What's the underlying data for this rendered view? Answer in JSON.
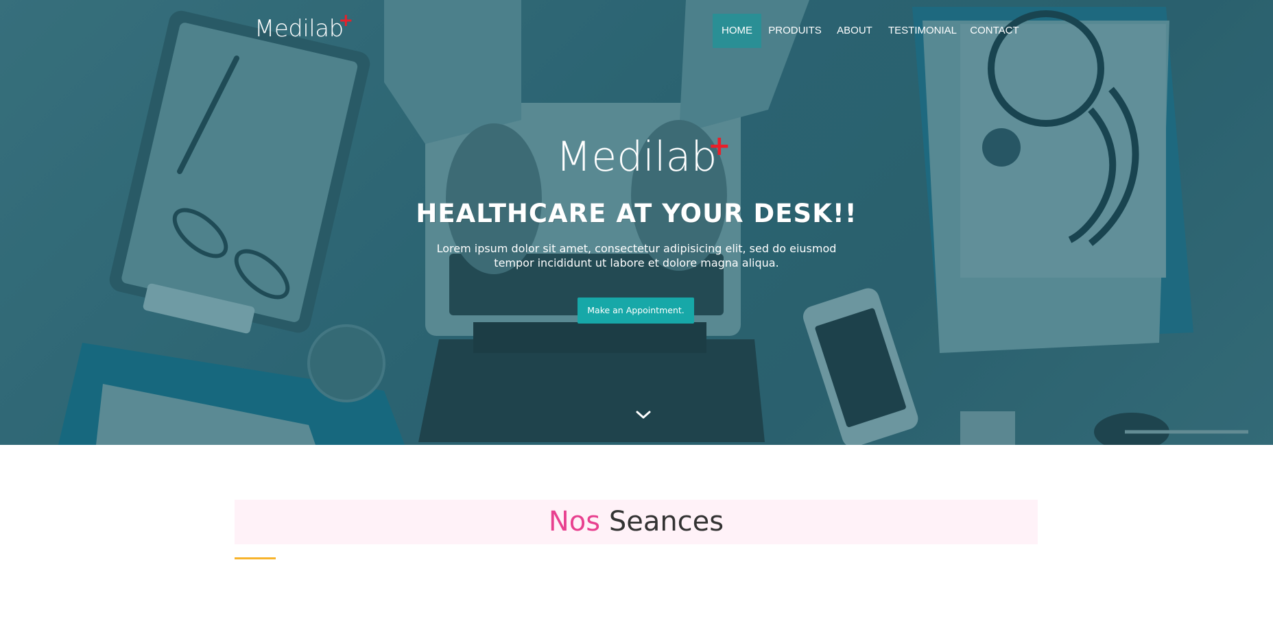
{
  "header": {
    "logo_text": "Medilab",
    "logo_plus": "+",
    "nav": [
      {
        "label": "HOME",
        "active": true
      },
      {
        "label": "PRODUITS",
        "active": false
      },
      {
        "label": "ABOUT",
        "active": false
      },
      {
        "label": "TESTIMONIAL",
        "active": false
      },
      {
        "label": "CONTACT",
        "active": false
      }
    ]
  },
  "hero": {
    "logo_text": "Medilab",
    "logo_plus": "+",
    "headline": "HEALTHCARE AT YOUR DESK!!",
    "lead_line1": "Lorem ipsum dolor sit amet, consectetur adipisicing elit, sed do eiusmod",
    "lead_line2": "tempor incididunt ut labore et dolore magna aliqua.",
    "cta_label": "Make an Appointment.",
    "scroll_icon": "chevron-down-icon"
  },
  "section": {
    "title_highlight": "Nos",
    "title_rest": "Seances"
  },
  "colors": {
    "accent": "#17a8a8",
    "nav_active": "#2a8f95",
    "plus_red": "#e8202a",
    "title_pink": "#e8408f",
    "underline_orange": "#f7b32b"
  }
}
